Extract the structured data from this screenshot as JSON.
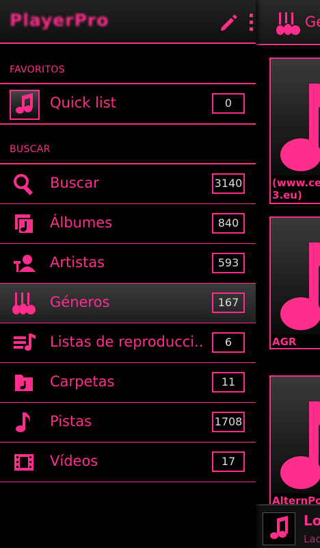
{
  "header": {
    "app_logo": "PlayerPro"
  },
  "background": {
    "title": "Ge",
    "cards": [
      {
        "caption": "(www.ce 3.eu)"
      },
      {
        "caption": "AGR"
      },
      {
        "caption": "AlternPo"
      }
    ],
    "now_playing": {
      "title": "Lo",
      "subtitle": "Lac"
    }
  },
  "favorites": {
    "section_label": "FAVORITOS",
    "items": [
      {
        "label": "Quick list",
        "count": "0",
        "icon": "music-note-icon"
      }
    ]
  },
  "search": {
    "section_label": "BUSCAR",
    "items": [
      {
        "label": "Buscar",
        "count": "3140",
        "icon": "search-icon"
      },
      {
        "label": "Álbumes",
        "count": "840",
        "icon": "albums-icon"
      },
      {
        "label": "Artistas",
        "count": "593",
        "icon": "artists-icon"
      },
      {
        "label": "Géneros",
        "count": "167",
        "icon": "guitars-icon"
      },
      {
        "label": "Listas de reproducci..",
        "count": "6",
        "icon": "playlist-icon"
      },
      {
        "label": "Carpetas",
        "count": "11",
        "icon": "folder-icon"
      },
      {
        "label": "Pistas",
        "count": "1708",
        "icon": "track-note-icon"
      },
      {
        "label": "Vídeos",
        "count": "17",
        "icon": "video-icon"
      }
    ]
  },
  "colors": {
    "accent": "#ff2d8c",
    "background": "#000000",
    "count_text": "#dcdcdc"
  }
}
